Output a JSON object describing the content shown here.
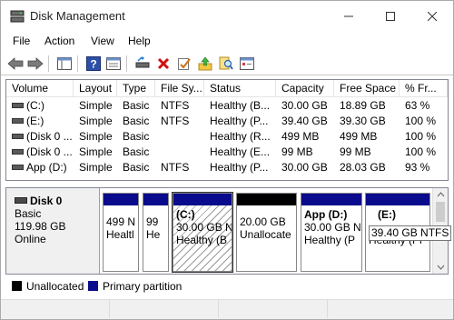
{
  "window": {
    "title": "Disk Management"
  },
  "menu": [
    "File",
    "Action",
    "View",
    "Help"
  ],
  "columns": [
    "Volume",
    "Layout",
    "Type",
    "File Sy...",
    "Status",
    "Capacity",
    "Free Space",
    "% Fr..."
  ],
  "volumes": [
    {
      "volume": "(C:)",
      "layout": "Simple",
      "type": "Basic",
      "fs": "NTFS",
      "status": "Healthy (B...",
      "capacity": "30.00 GB",
      "free": "18.89 GB",
      "pct": "63 %"
    },
    {
      "volume": "(E:)",
      "layout": "Simple",
      "type": "Basic",
      "fs": "NTFS",
      "status": "Healthy (P...",
      "capacity": "39.40 GB",
      "free": "39.30 GB",
      "pct": "100 %"
    },
    {
      "volume": "(Disk 0 ...",
      "layout": "Simple",
      "type": "Basic",
      "fs": "",
      "status": "Healthy (R...",
      "capacity": "499 MB",
      "free": "499 MB",
      "pct": "100 %"
    },
    {
      "volume": "(Disk 0 ...",
      "layout": "Simple",
      "type": "Basic",
      "fs": "",
      "status": "Healthy (E...",
      "capacity": "99 MB",
      "free": "99 MB",
      "pct": "100 %"
    },
    {
      "volume": "App (D:)",
      "layout": "Simple",
      "type": "Basic",
      "fs": "NTFS",
      "status": "Healthy (P...",
      "capacity": "30.00 GB",
      "free": "28.03 GB",
      "pct": "93 %"
    }
  ],
  "disk": {
    "name": "Disk 0",
    "type": "Basic",
    "size": "119.98 GB",
    "state": "Online"
  },
  "partitions": [
    {
      "label": "",
      "size": "499 N",
      "status": "Healtl",
      "kind": "primary"
    },
    {
      "label": "",
      "size": "99",
      "status": "He",
      "kind": "primary"
    },
    {
      "label": "(C:)",
      "size": "30.00 GB N",
      "status": "Healthy (B",
      "kind": "primary"
    },
    {
      "label": "",
      "size": "20.00 GB",
      "status": "Unallocate",
      "kind": "unallocated"
    },
    {
      "label": "App  (D:)",
      "size": "30.00 GB N",
      "status": "Healthy (P",
      "kind": "primary"
    },
    {
      "label": "(E:)",
      "size": "",
      "status": "Healthy (Pr",
      "kind": "primary"
    }
  ],
  "tooltip": "39.40 GB NTFS",
  "legend": {
    "unallocated": "Unallocated",
    "primary": "Primary partition"
  },
  "colors": {
    "primary": "#0a0a8c",
    "unallocated": "#000000",
    "accent": "#0a246a"
  },
  "icons": [
    "back-icon",
    "forward-icon",
    "console-tree-icon",
    "help-icon",
    "properties-icon",
    "rescan-icon",
    "delete-icon",
    "check-icon",
    "import-icon",
    "search-icon",
    "settings-icon"
  ]
}
